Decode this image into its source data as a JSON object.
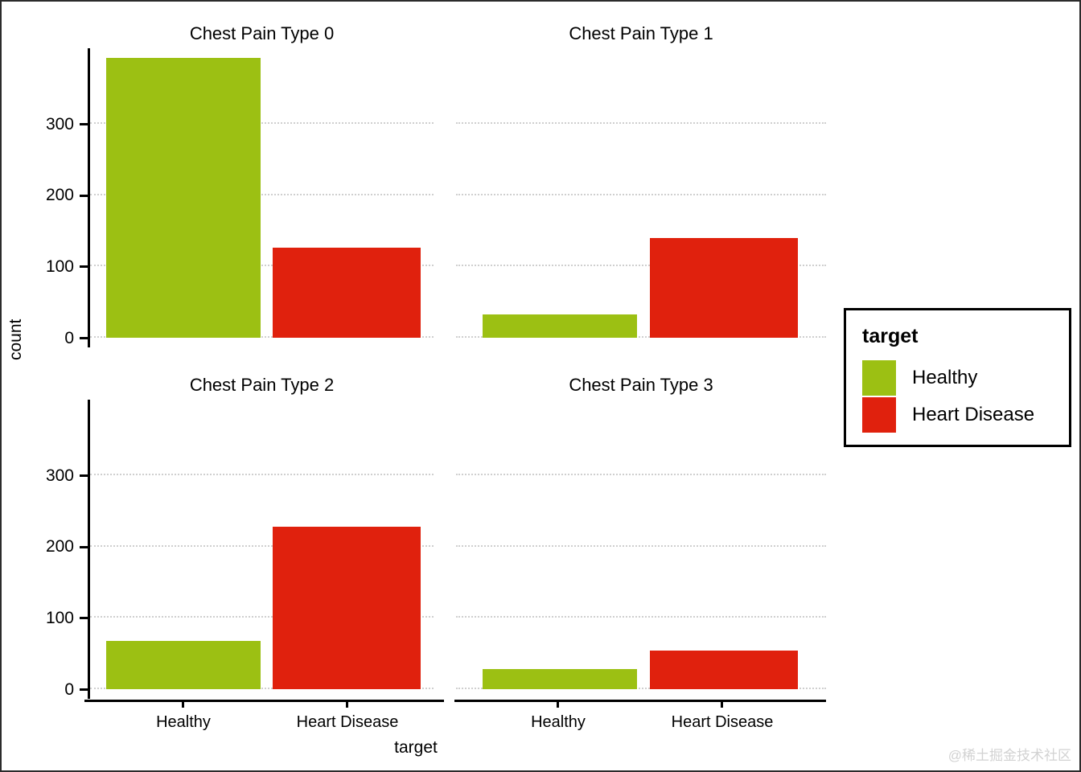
{
  "chart_data": {
    "type": "bar",
    "title": "",
    "xlabel": "target",
    "ylabel": "count",
    "categories": [
      "Healthy",
      "Heart Disease"
    ],
    "ylim": [
      0,
      385
    ],
    "yticks": [
      0,
      100,
      200,
      300
    ],
    "ytick_labels": [
      "0",
      "100",
      "200",
      "300"
    ],
    "grid": true,
    "legend": {
      "title": "target",
      "position": "right",
      "entries": [
        {
          "name": "Healthy",
          "color": "#9cc013"
        },
        {
          "name": "Heart Disease",
          "color": "#e0210d"
        }
      ]
    },
    "facets": [
      {
        "title": "Chest Pain Type 0",
        "values": [
          377,
          122
        ],
        "bars": [
          {
            "category": "Healthy",
            "value": 377,
            "color": "#9cc013"
          },
          {
            "category": "Heart Disease",
            "value": 122,
            "color": "#e0210d"
          }
        ]
      },
      {
        "title": "Chest Pain Type 1",
        "values": [
          32,
          135
        ],
        "bars": [
          {
            "category": "Healthy",
            "value": 32,
            "color": "#9cc013"
          },
          {
            "category": "Heart Disease",
            "value": 135,
            "color": "#e0210d"
          }
        ]
      },
      {
        "title": "Chest Pain Type 2",
        "values": [
          65,
          219
        ],
        "bars": [
          {
            "category": "Healthy",
            "value": 65,
            "color": "#9cc013"
          },
          {
            "category": "Heart Disease",
            "value": 219,
            "color": "#e0210d"
          }
        ]
      },
      {
        "title": "Chest Pain Type 3",
        "values": [
          27,
          52
        ],
        "bars": [
          {
            "category": "Healthy",
            "value": 27,
            "color": "#9cc013"
          },
          {
            "category": "Heart Disease",
            "value": 52,
            "color": "#e0210d"
          }
        ]
      }
    ]
  },
  "axes": {
    "ylabel": "count",
    "xlabel": "target",
    "ytick_labels": [
      "0",
      "100",
      "200",
      "300"
    ],
    "xtick_labels": [
      "Healthy",
      "Heart Disease"
    ]
  },
  "panels": [
    {
      "title": "Chest Pain Type 0"
    },
    {
      "title": "Chest Pain Type 1"
    },
    {
      "title": "Chest Pain Type 2"
    },
    {
      "title": "Chest Pain Type 3"
    }
  ],
  "legend": {
    "title": "target",
    "items": [
      {
        "label": "Healthy"
      },
      {
        "label": "Heart Disease"
      }
    ]
  },
  "watermark": {
    "text": "@稀土掘金技术社区"
  },
  "colors": {
    "healthy": "#9cc013",
    "disease": "#e0210d",
    "grid": "#cfcfcf",
    "axis": "#000000",
    "background": "#ffffff",
    "border": "#2b2b2b"
  }
}
